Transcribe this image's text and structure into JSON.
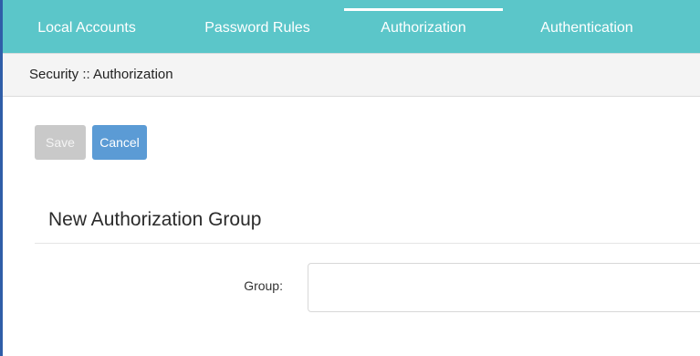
{
  "tabs": [
    {
      "label": "Local Accounts",
      "active": false
    },
    {
      "label": "Password Rules",
      "active": false
    },
    {
      "label": "Authorization",
      "active": true
    },
    {
      "label": "Authentication",
      "active": false
    }
  ],
  "breadcrumb": "Security :: Authorization",
  "toolbar": {
    "save_label": "Save",
    "save_enabled": false,
    "cancel_label": "Cancel"
  },
  "form": {
    "title": "New Authorization Group",
    "group_label": "Group:",
    "group_value": "",
    "group_placeholder": ""
  },
  "colors": {
    "tab_bar": "#5bc6c9",
    "cancel_button": "#5b9bd5",
    "save_button_disabled": "#c9c9c9",
    "left_border": "#2f5ea8"
  }
}
